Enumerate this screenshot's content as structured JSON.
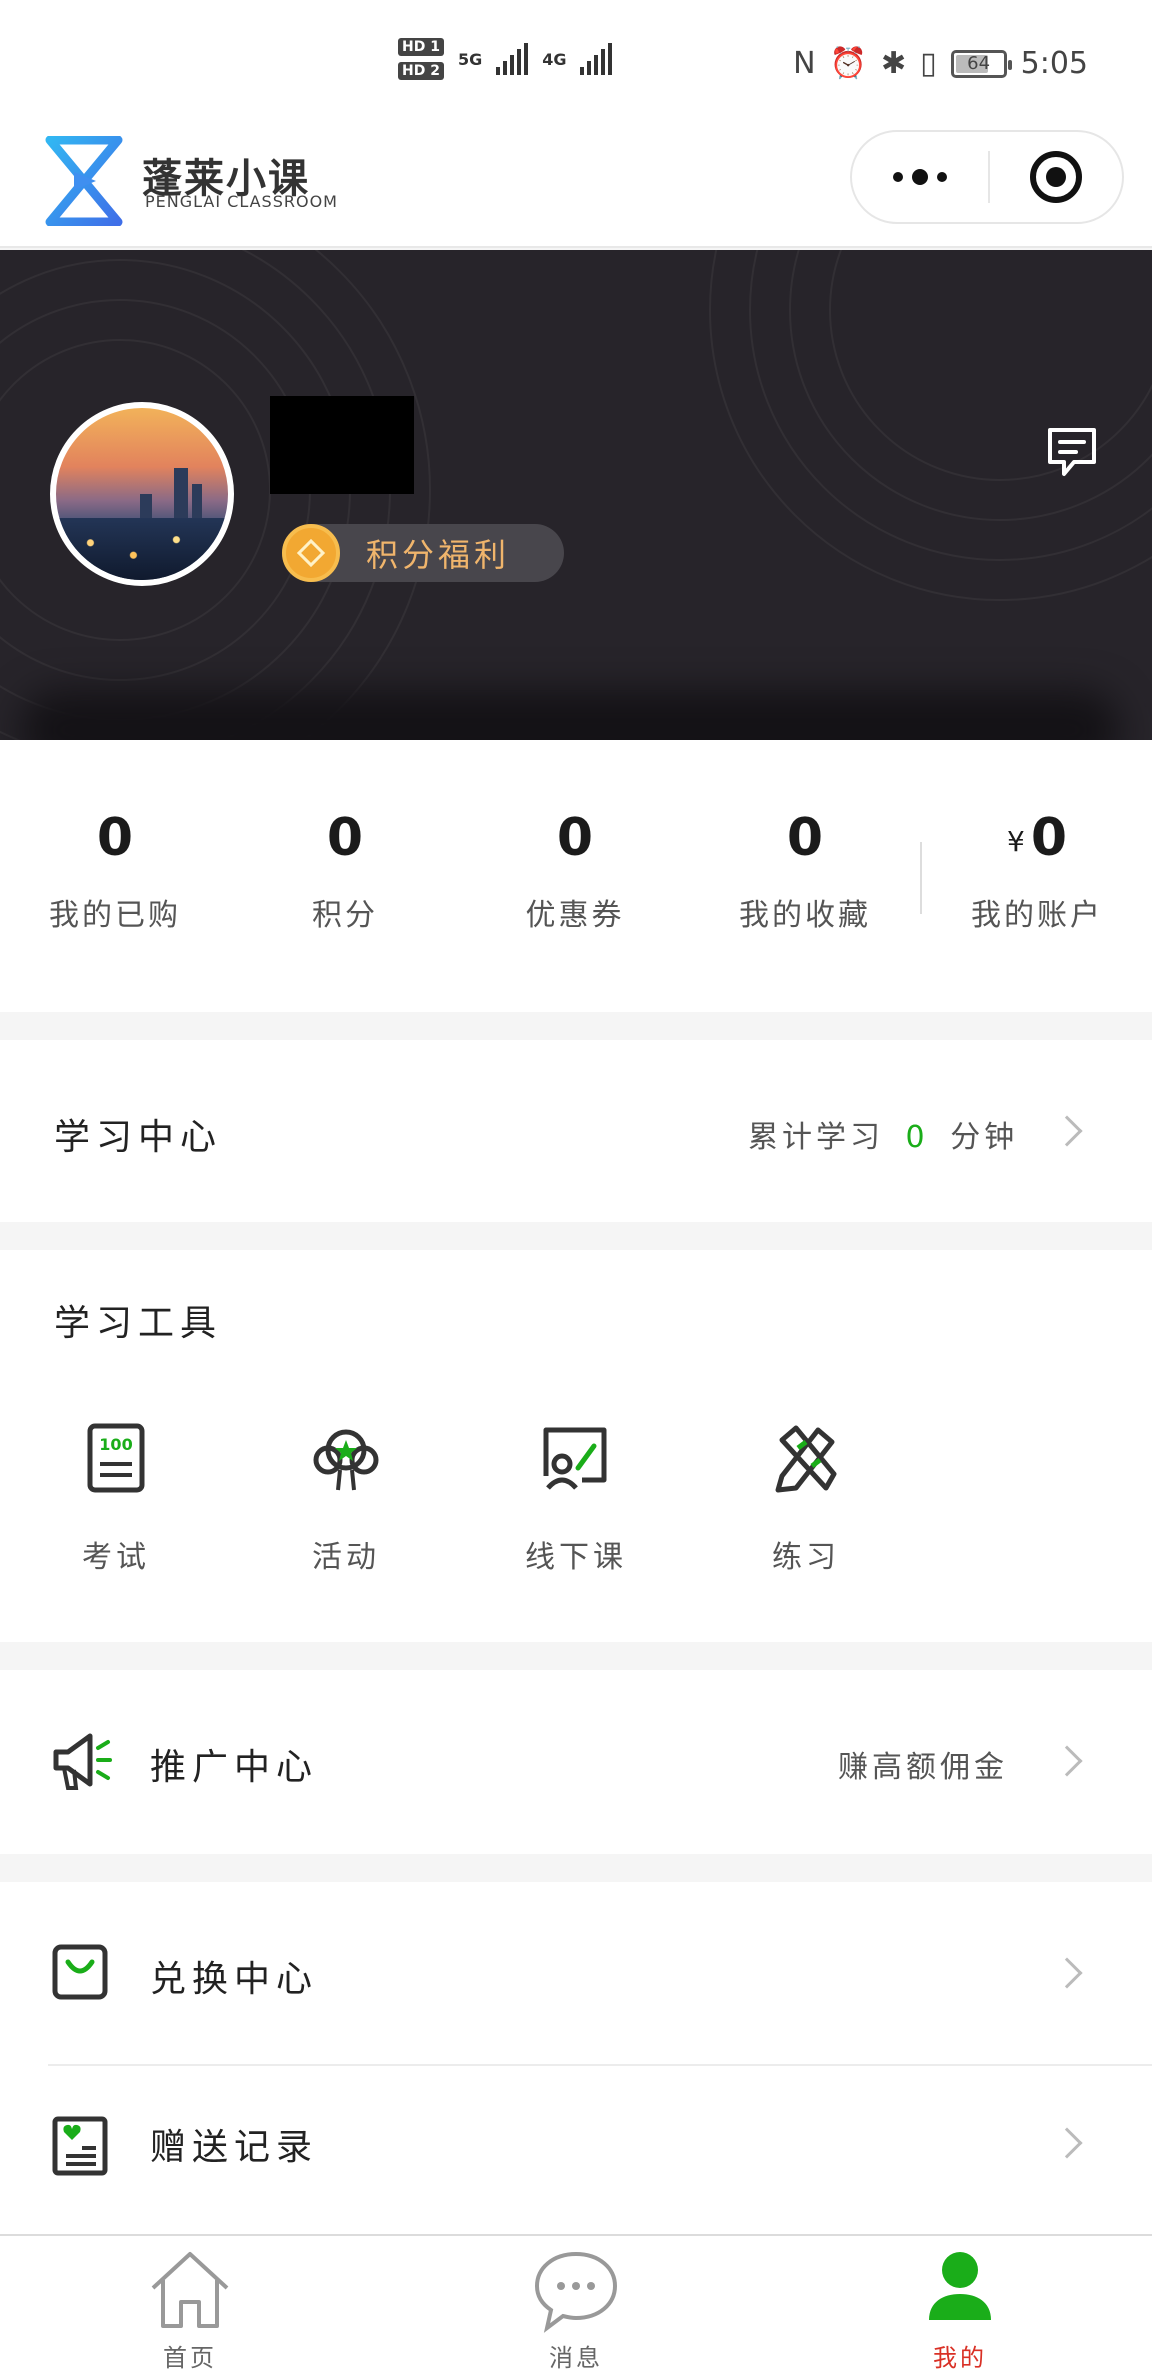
{
  "status_bar": {
    "hd1": "HD 1",
    "hd2": "HD 2",
    "net1": "5G",
    "net2": "4G",
    "battery": "64",
    "time": "5:05"
  },
  "header": {
    "brand_name": "蓬莱小课",
    "brand_sub": "PENGLAI CLASSROOM"
  },
  "profile": {
    "points_badge": "积分福利"
  },
  "stats": [
    {
      "value": "0",
      "label": "我的已购"
    },
    {
      "value": "0",
      "label": "积分"
    },
    {
      "value": "0",
      "label": "优惠券"
    },
    {
      "value": "0",
      "label": "我的收藏"
    },
    {
      "currency": "¥",
      "value": "0",
      "label": "我的账户"
    }
  ],
  "learning_center": {
    "title": "学习中心",
    "summary_prefix": "累计学习",
    "minutes": "0",
    "summary_suffix": "分钟"
  },
  "tools": {
    "title": "学习工具",
    "items": [
      {
        "label": "考试",
        "icon": "exam-icon"
      },
      {
        "label": "活动",
        "icon": "activity-icon"
      },
      {
        "label": "线下课",
        "icon": "offline-class-icon"
      },
      {
        "label": "练习",
        "icon": "practice-icon"
      }
    ]
  },
  "promo": {
    "title": "推广中心",
    "hint": "赚高额佣金"
  },
  "menu": [
    {
      "label": "兑换中心",
      "icon": "shopping-bag-icon"
    },
    {
      "label": "赠送记录",
      "icon": "gift-record-icon"
    }
  ],
  "tabbar": [
    {
      "label": "首页",
      "icon": "home-icon",
      "active": false
    },
    {
      "label": "消息",
      "icon": "chat-icon",
      "active": false
    },
    {
      "label": "我的",
      "icon": "user-icon",
      "active": true
    }
  ],
  "colors": {
    "accent_green": "#1aad19",
    "active_tab_red": "#d93025",
    "hero_bg": "#27242a",
    "points_gold": "#f0b56c"
  }
}
